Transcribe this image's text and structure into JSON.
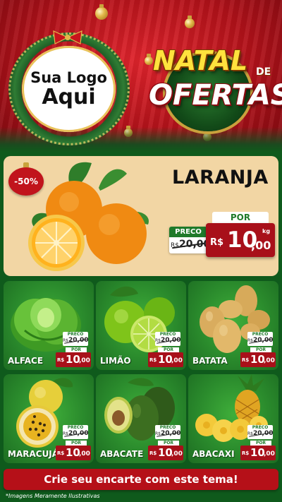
{
  "header": {
    "logo_line1": "Sua Logo",
    "logo_line2": "Aqui",
    "title_natal": "NATAL",
    "title_de": "DE",
    "title_ofertas": "OFERTAS"
  },
  "featured": {
    "discount": "-50%",
    "name": "LARANJA",
    "preco_label": "PRECO",
    "old_currency": "R$",
    "old_price": "20,00",
    "por_label": "POR",
    "new_currency": "R$",
    "new_price_int": "10",
    "new_price_dec": ",00",
    "unit": "kg"
  },
  "products": [
    {
      "name": "ALFACE",
      "preco_label": "PRECO",
      "old_currency": "R$",
      "old_price": "20,00",
      "por_label": "POR",
      "new_currency": "R$",
      "new_price_int": "10",
      "new_price_dec": ",00",
      "icon": "lettuce-icon"
    },
    {
      "name": "LIMÃO",
      "preco_label": "PRECO",
      "old_currency": "R$",
      "old_price": "20,00",
      "por_label": "POR",
      "new_currency": "R$",
      "new_price_int": "10",
      "new_price_dec": ",00",
      "icon": "lime-icon"
    },
    {
      "name": "BATATA",
      "preco_label": "PRECO",
      "old_currency": "R$",
      "old_price": "20,00",
      "por_label": "POR",
      "new_currency": "R$",
      "new_price_int": "10",
      "new_price_dec": ",00",
      "icon": "potato-icon"
    },
    {
      "name": "MARACUJÁ",
      "preco_label": "PRECO",
      "old_currency": "R$",
      "old_price": "20,00",
      "por_label": "POR",
      "new_currency": "R$",
      "new_price_int": "10",
      "new_price_dec": ",00",
      "icon": "passion-fruit-icon"
    },
    {
      "name": "ABACATE",
      "preco_label": "PRECO",
      "old_currency": "R$",
      "old_price": "20,00",
      "por_label": "POR",
      "new_currency": "R$",
      "new_price_int": "10",
      "new_price_dec": ",00",
      "icon": "avocado-icon"
    },
    {
      "name": "ABACAXI",
      "preco_label": "PRECO",
      "old_currency": "R$",
      "old_price": "20,00",
      "por_label": "POR",
      "new_currency": "R$",
      "new_price_int": "10",
      "new_price_dec": ",00",
      "icon": "pineapple-icon"
    }
  ],
  "footer": {
    "cta": "Crie seu encarte com este tema!",
    "disclaimer": "*Imagens Meramente Ilustrativas"
  },
  "colors": {
    "brand_red": "#b51018",
    "brand_green": "#1f7a2a",
    "accent_gold": "#e3b84a",
    "featured_bg": "#f2d6a4"
  }
}
